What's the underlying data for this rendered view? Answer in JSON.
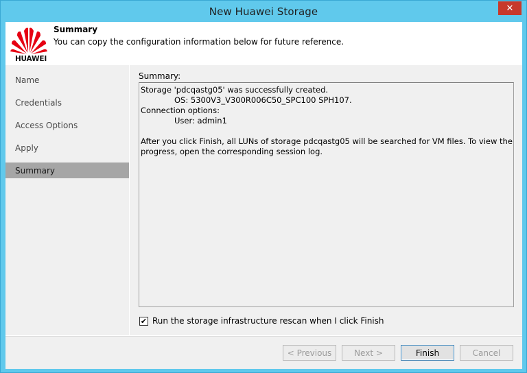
{
  "window": {
    "title": "New Huawei Storage",
    "close_glyph": "✕"
  },
  "header": {
    "logo_text": "HUAWEI",
    "title": "Summary",
    "subtitle": "You can copy the configuration information below for future reference.",
    "logo_color": "#e60012"
  },
  "sidebar": {
    "items": [
      {
        "label": "Name"
      },
      {
        "label": "Credentials"
      },
      {
        "label": "Access Options"
      },
      {
        "label": "Apply"
      },
      {
        "label": "Summary",
        "active": true
      }
    ]
  },
  "content": {
    "summary_label": "Summary:",
    "summary_lines": [
      "Storage 'pdcqastg05' was successfully created.",
      "OS: 5300V3_V300R006C50_SPC100 SPH107.",
      "Connection options:",
      "User: admin1",
      "",
      "After you click Finish, all LUNs of storage pdcqastg05 will be searched for VM files. To view the",
      "progress, open the corresponding session log."
    ],
    "rescan_checkbox": {
      "label": "Run the storage infrastructure rescan when I click Finish",
      "checked": true,
      "glyph": "✔"
    }
  },
  "footer": {
    "previous_label": "< Previous",
    "next_label": "Next >",
    "finish_label": "Finish",
    "cancel_label": "Cancel"
  },
  "colors": {
    "titlebar": "#60c9ec",
    "close_button": "#c7392b",
    "active_step": "#a6a6a6"
  }
}
